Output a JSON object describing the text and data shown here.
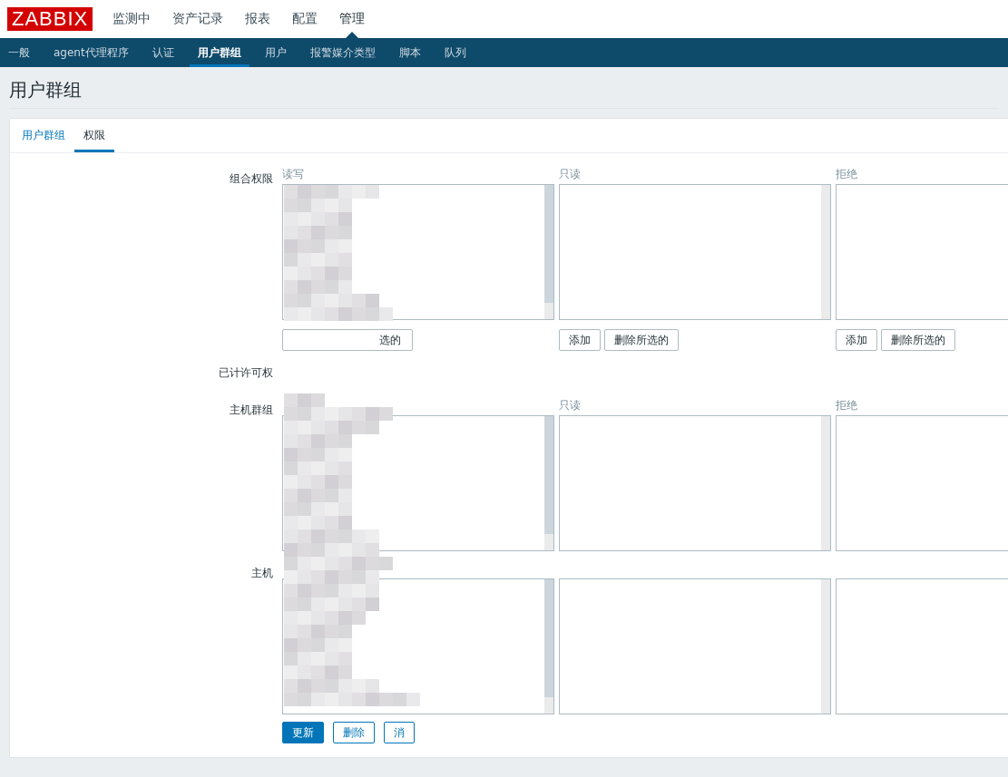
{
  "logo": "ZABBIX",
  "main_menu": [
    {
      "label": "监测中",
      "selected": false
    },
    {
      "label": "资产记录",
      "selected": false
    },
    {
      "label": "报表",
      "selected": false
    },
    {
      "label": "配置",
      "selected": false
    },
    {
      "label": "管理",
      "selected": true
    }
  ],
  "sub_menu": [
    {
      "label": "一般",
      "selected": false
    },
    {
      "label": "agent代理程序",
      "selected": false
    },
    {
      "label": "认证",
      "selected": false
    },
    {
      "label": "用户群组",
      "selected": true
    },
    {
      "label": "用户",
      "selected": false
    },
    {
      "label": "报警媒介类型",
      "selected": false
    },
    {
      "label": "脚本",
      "selected": false
    },
    {
      "label": "队列",
      "selected": false
    }
  ],
  "page_title": "用户群组",
  "tabs": [
    {
      "label": "用户群组",
      "selected": false
    },
    {
      "label": "权限",
      "selected": true
    }
  ],
  "sections": [
    {
      "kind": "lists",
      "label": "组合权限",
      "columns": [
        {
          "heading": "读写",
          "scrollable": true,
          "buttons": [
            "选的"
          ]
        },
        {
          "heading": "只读",
          "scrollable": false,
          "buttons": [
            "添加",
            "删除所选的"
          ]
        },
        {
          "heading": "拒绝",
          "buttons": [
            "添加",
            "删除所选的"
          ]
        }
      ]
    },
    {
      "kind": "heading",
      "label": "已计许可权"
    },
    {
      "kind": "lists",
      "label": "主机群组",
      "columns": [
        {
          "scrollable": true
        },
        {
          "heading": "只读",
          "scrollable": false
        },
        {
          "heading": "拒绝"
        }
      ]
    },
    {
      "kind": "lists",
      "label": "主机",
      "columns": [
        {
          "scrollable": true
        },
        {
          "scrollable": false
        },
        {}
      ]
    }
  ],
  "form_buttons": [
    {
      "label": "更新",
      "kind": "primary"
    },
    {
      "label": "删除",
      "kind": "secondary"
    },
    {
      "label": "消",
      "kind": "secondary"
    }
  ]
}
